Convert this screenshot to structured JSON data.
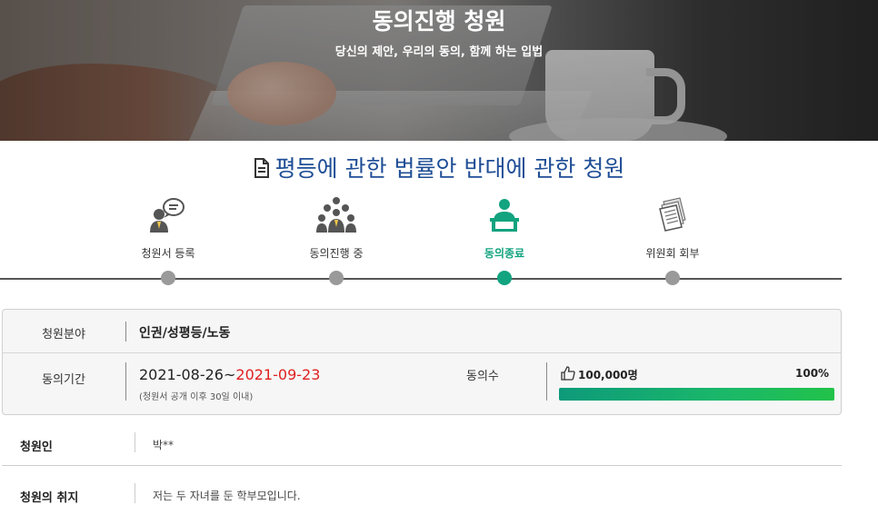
{
  "hero": {
    "title": "동의진행 청원",
    "subtitle": "당신의 제안, 우리의 동의, 함께 하는 입법"
  },
  "petition": {
    "title": "평등에 관한 법률안 반대에 관한 청원"
  },
  "steps": [
    {
      "label": "청원서 등록",
      "icon": "speech-person-icon",
      "active": false
    },
    {
      "label": "동의진행 중",
      "icon": "group-people-icon",
      "active": false
    },
    {
      "label": "동의종료",
      "icon": "presenter-podium-icon",
      "active": true
    },
    {
      "label": "위원회 회부",
      "icon": "document-stack-icon",
      "active": false
    }
  ],
  "info": {
    "category_label": "청원분야",
    "category_value": "인권/성평등/노동",
    "period_label": "동의기간",
    "period_start": "2021-08-26~",
    "period_end": "2021-09-23",
    "period_note": "(청원서 공개 이후 30일 이내)",
    "agree_label": "동의수",
    "agree_count": "100,000명",
    "agree_percent": "100%",
    "agree_fraction": 1.0
  },
  "petitioner": {
    "label": "청원인",
    "value": "박**"
  },
  "purpose": {
    "label": "청원의 취지",
    "value": "저는 두 자녀를 둔 학부모입니다."
  },
  "colors": {
    "title_blue": "#1f4e96",
    "active_green": "#12a37f",
    "date_red": "#e02020"
  }
}
